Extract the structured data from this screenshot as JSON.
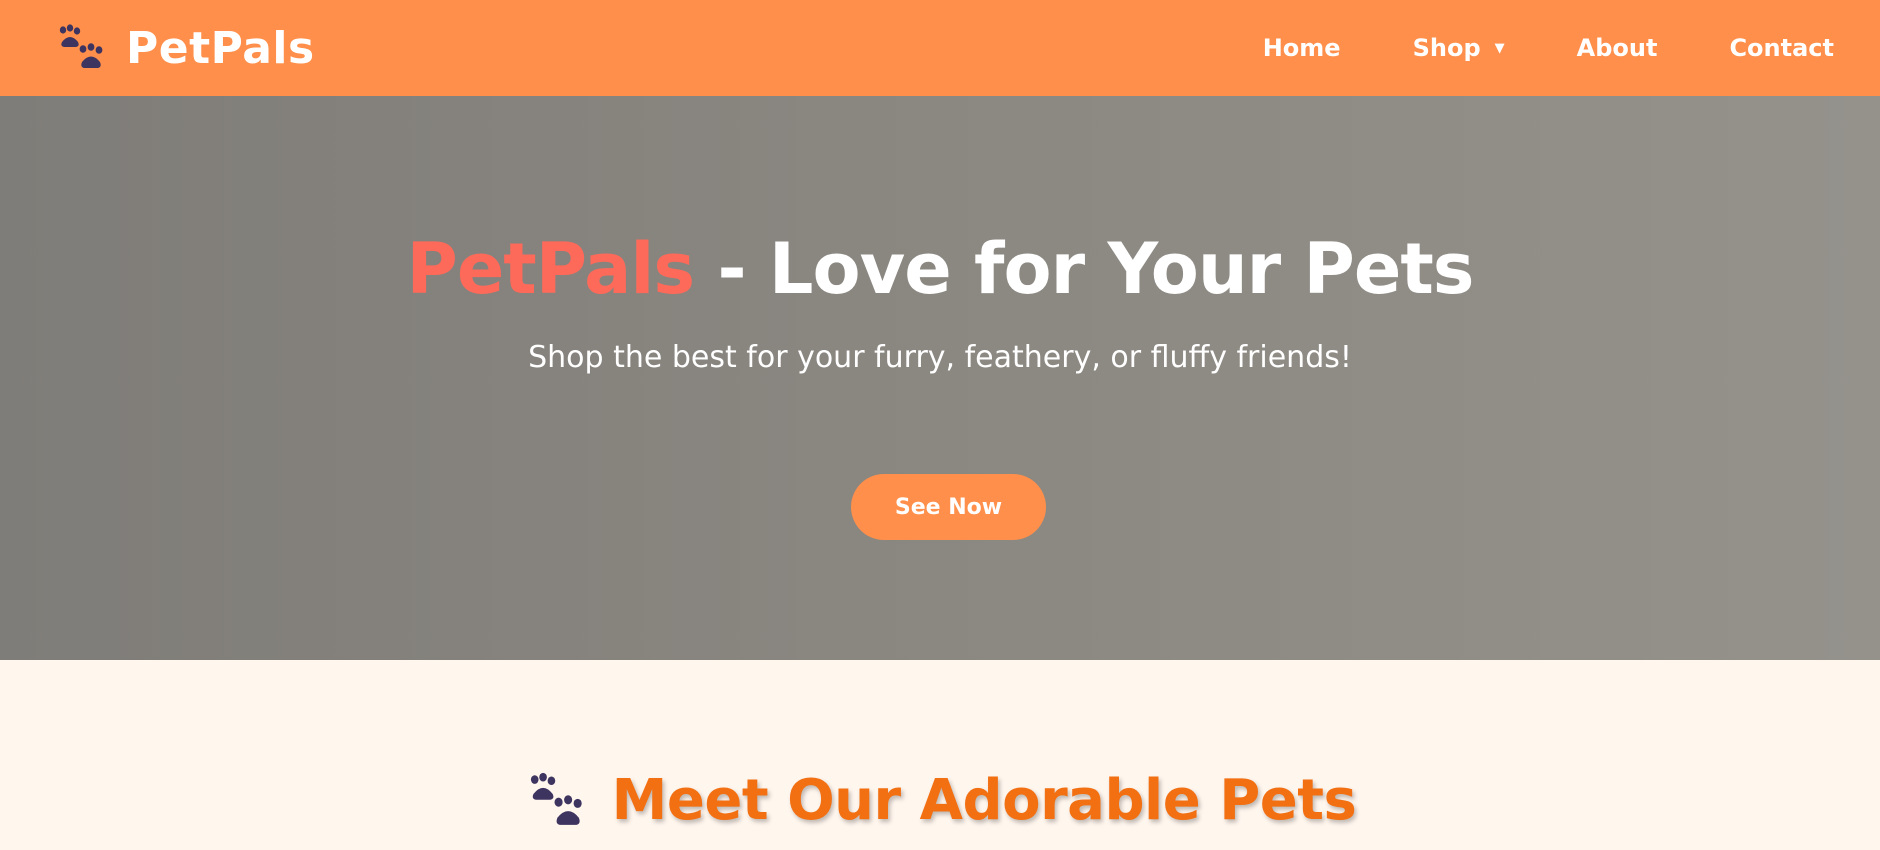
{
  "navbar": {
    "brand_name": "PetPals",
    "brand_icon": "paw-prints-icon",
    "links": [
      {
        "label": "Home"
      },
      {
        "label": "Shop",
        "has_dropdown": true,
        "caret": "▼"
      },
      {
        "label": "About"
      },
      {
        "label": "Contact"
      }
    ]
  },
  "hero": {
    "title_accent": "PetPals",
    "title_rest": " - Love for Your Pets",
    "subtitle": "Shop the best for your furry, feathery, or fluffy friends!",
    "cta_label": "See Now"
  },
  "pets_section": {
    "icon": "paw-prints-icon",
    "heading": "Meet Our Adorable Pets"
  },
  "colors": {
    "nav_bg": "#ff8f4a",
    "accent": "#fd6a5a",
    "heading": "#f26f12",
    "paw": "#3d3460",
    "hero_bg": "#8a8680",
    "section_bg": "#fff6ee"
  }
}
